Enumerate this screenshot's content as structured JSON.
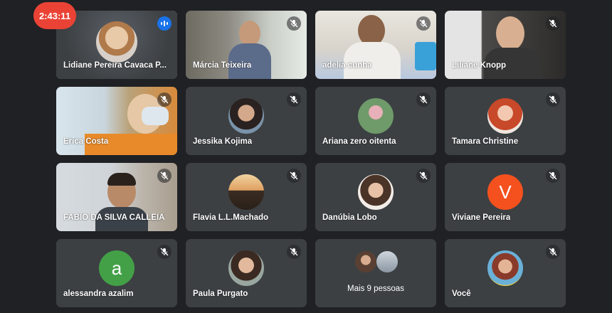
{
  "timer": "2:43:11",
  "colors": {
    "accent": "#1a73e8",
    "tile": "#3c4043",
    "timer": "#ea4335",
    "avatar_v": "#f4511e",
    "avatar_a": "#43a047"
  },
  "participants": [
    {
      "name": "Lidiane Pereira Cavaca P...",
      "kind": "video",
      "mic": "speaking"
    },
    {
      "name": "Márcia Teixeira",
      "kind": "video",
      "mic": "muted"
    },
    {
      "name": "adelia cunha",
      "kind": "video",
      "mic": "muted"
    },
    {
      "name": "Liliane Knopp",
      "kind": "video",
      "mic": "muted"
    },
    {
      "name": "Érica Costa",
      "kind": "video",
      "mic": "muted"
    },
    {
      "name": "Jessika Kojima",
      "kind": "photo-avatar",
      "mic": "muted"
    },
    {
      "name": "Ariana zero oitenta",
      "kind": "photo-avatar",
      "mic": "muted"
    },
    {
      "name": "Tamara Christine",
      "kind": "photo-avatar",
      "mic": "muted"
    },
    {
      "name": "FABIO DA SILVA CALLEIA",
      "kind": "video",
      "mic": "muted"
    },
    {
      "name": "Flavia L.L.Machado",
      "kind": "photo-avatar",
      "mic": "muted"
    },
    {
      "name": "Danúbia Lobo",
      "kind": "photo-avatar",
      "mic": "muted"
    },
    {
      "name": "Viviane Pereira",
      "kind": "letter-avatar",
      "letter": "V",
      "mic": "muted"
    },
    {
      "name": "alessandra azalim",
      "kind": "letter-avatar",
      "letter": "a",
      "mic": "muted"
    },
    {
      "name": "Paula Purgato",
      "kind": "photo-avatar",
      "mic": "muted"
    },
    {
      "label": "Mais 9 pessoas",
      "kind": "overflow"
    },
    {
      "name": "Você",
      "kind": "photo-avatar",
      "mic": "muted"
    }
  ]
}
